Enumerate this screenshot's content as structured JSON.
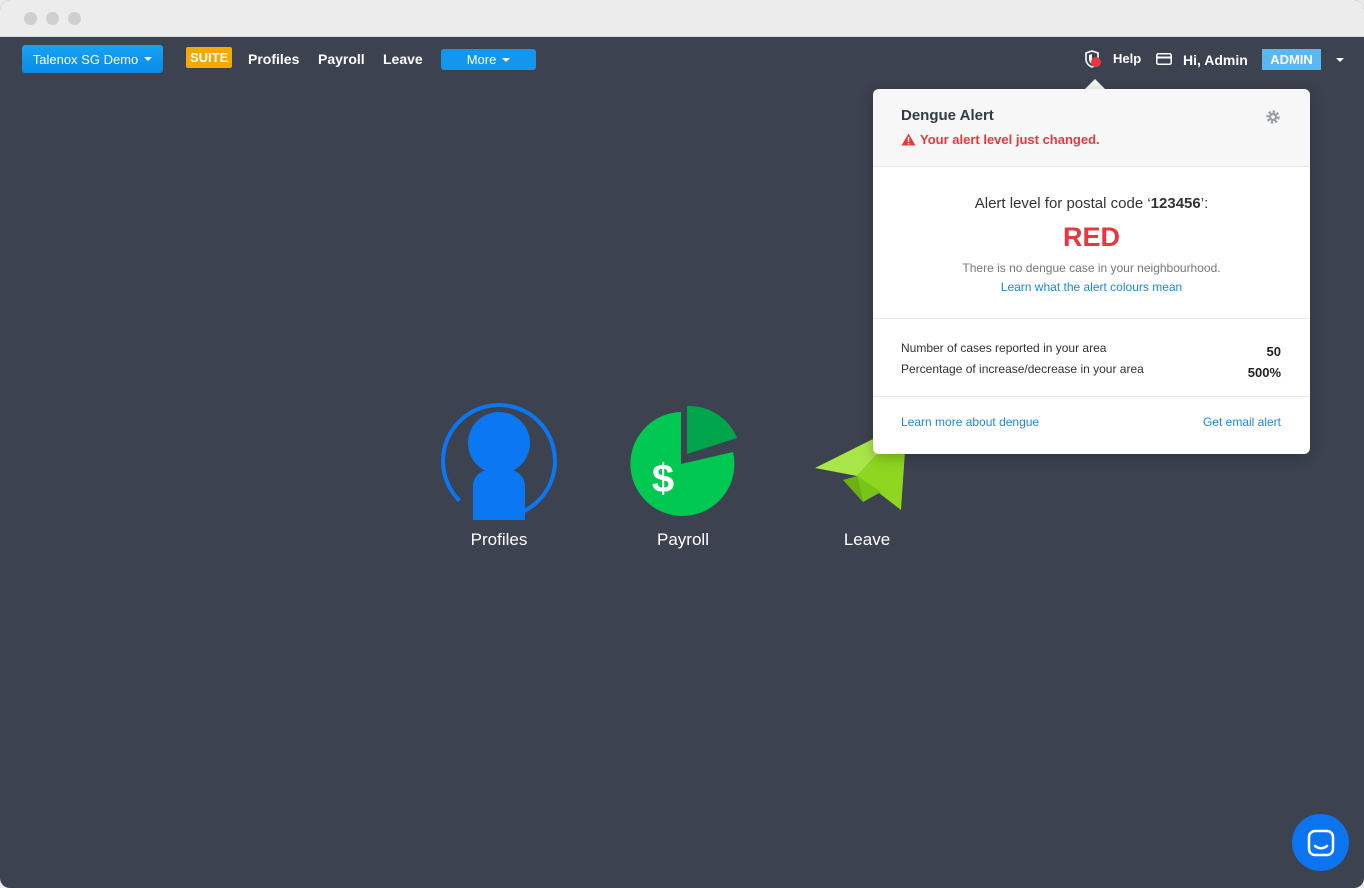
{
  "nav": {
    "company_label": "Talenox SG Demo",
    "suite_label": "SUITE",
    "links": [
      "Profiles",
      "Payroll",
      "Leave"
    ],
    "more_label": "More",
    "help_label": "Help",
    "greeting": "Hi, Admin",
    "role_badge": "ADMIN"
  },
  "modules": [
    {
      "label": "Profiles",
      "icon": "profile-icon",
      "color": "#0b77f2"
    },
    {
      "label": "Payroll",
      "icon": "payroll-icon",
      "color": "#00c853"
    },
    {
      "label": "Leave",
      "icon": "paper-plane-icon",
      "color": "#8ed61f"
    }
  ],
  "popover": {
    "title": "Dengue Alert",
    "warning": "Your alert level just changed.",
    "level_prefix": "Alert level for postal code ‘",
    "postal_code": "123456",
    "level_suffix": "’:",
    "level": "RED",
    "description": "There is no dengue case in your neighbourhood.",
    "colours_link": "Learn what the alert colours mean",
    "stats": [
      {
        "label": "Number of cases reported in your area",
        "value": "50"
      },
      {
        "label": "Percentage of increase/decrease in your area",
        "value": "500%"
      }
    ],
    "learn_more_link": "Learn more about dengue",
    "email_alert_link": "Get email alert"
  },
  "colors": {
    "background": "#3d4250",
    "accent": "#1396ee",
    "alert_red": "#e8383d",
    "suite": "#f6a800"
  }
}
